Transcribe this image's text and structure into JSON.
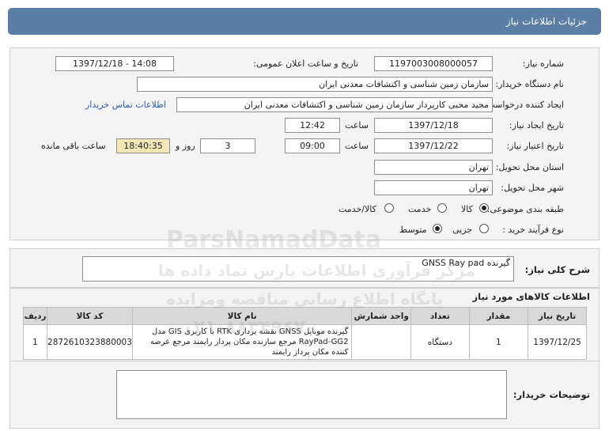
{
  "header": {
    "title": "جزئیات اطلاعات نیاز"
  },
  "form": {
    "need_number_label": "شماره نیاز:",
    "need_number": "1197003008000057",
    "announce_label": "تاریخ و ساعت اعلان عمومی:",
    "announce_value": "1397/12/18 - 14:08",
    "buyer_org_label": "نام دستگاه خریدار:",
    "buyer_org": "سازمان زمین شناسی و اکتشافات معدنی ایران",
    "requester_label": "ایجاد کننده درخواست:",
    "requester": "مجید محبی کارپرداز سازمان زمین شناسی و اکتشافات معدنی ایران",
    "contact_link": "اطلاعات تماس خریدار",
    "created_label": "تاریخ ایجاد نیاز:",
    "created_date": "1397/12/18",
    "time_label": "ساعت",
    "created_time": "12:42",
    "validity_label": "تاریخ اعتبار نیاز:",
    "validity_date": "1397/12/22",
    "validity_time": "09:00",
    "days_value": "3",
    "days_label": "روز و",
    "remaining_value": "18:40:35",
    "remaining_label": "ساعت باقی مانده",
    "province_label": "استان محل تحویل:",
    "province": "تهران",
    "city_label": "شهر محل تحویل:",
    "city": "تهران",
    "category_label": "طبقه بندی موضوعی:",
    "category_options": [
      "کالا",
      "خدمت",
      "کالا/خدمت"
    ],
    "process_label": "نوع فرآیند خرید :",
    "process_options": [
      "جزیی",
      "متوسط"
    ]
  },
  "summary": {
    "label": "شرح کلی نیاز:",
    "value": "گیرنده GNSS  Ray pad"
  },
  "items": {
    "title": "اطلاعات کالاهای مورد نیاز",
    "headers": [
      "ردیف",
      "کد کالا",
      "نام کالا",
      "واحد شمارش",
      "تعداد / مقدار",
      "تاریخ نیاز"
    ],
    "rows": [
      {
        "row": "1",
        "code": "2872610323880003",
        "name": "گیرنده موبایل GNSS نقشه برداری RTK با کاربری GIS مدل RayPad-GG2 مرجع سازنده مکان پرداز رایمند مرجع عرضه کننده مکان پرداز رایمند",
        "unit": "دستگاه",
        "qty": "1",
        "date": "1397/12/25"
      }
    ]
  },
  "buyer_notes": {
    "label": "توضیحات خریدار:",
    "value": ""
  },
  "watermark": {
    "line1": "ParsNamadData",
    "line2": "مرکز فرآوری اطلاعات پارس نماد داده ها",
    "line3": "پایگاه اطلاع رسانی مناقصه ومزایده",
    "line4": "۰۲۱-۸۸۳۴۹۶۷۰"
  },
  "colors": {
    "header_bg": "#5a7ea6",
    "link": "#2a5db0",
    "remaining_bg": "#f3e8b5"
  }
}
